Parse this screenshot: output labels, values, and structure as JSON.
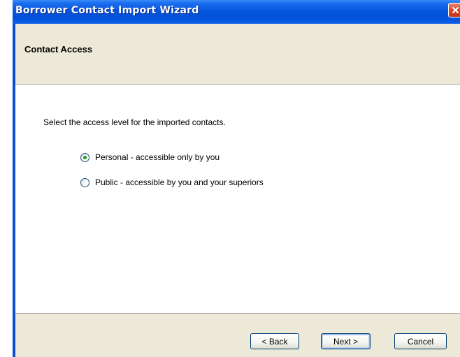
{
  "window": {
    "title": "Borrower Contact Import Wizard",
    "close_icon": "close-icon"
  },
  "header": {
    "title": "Contact Access"
  },
  "content": {
    "instruction": "Select the access level for the imported contacts.",
    "options": [
      {
        "label": "Personal - accessible only by you",
        "selected": true
      },
      {
        "label": "Public - accessible by you and your superiors",
        "selected": false
      }
    ]
  },
  "footer": {
    "back_label": "< Back",
    "next_label": "Next >",
    "cancel_label": "Cancel"
  },
  "colors": {
    "titlebar": "#0a4cd2",
    "dialog_face": "#ece9d8",
    "radio_dot": "#21a121",
    "close_button": "#d5462a"
  }
}
